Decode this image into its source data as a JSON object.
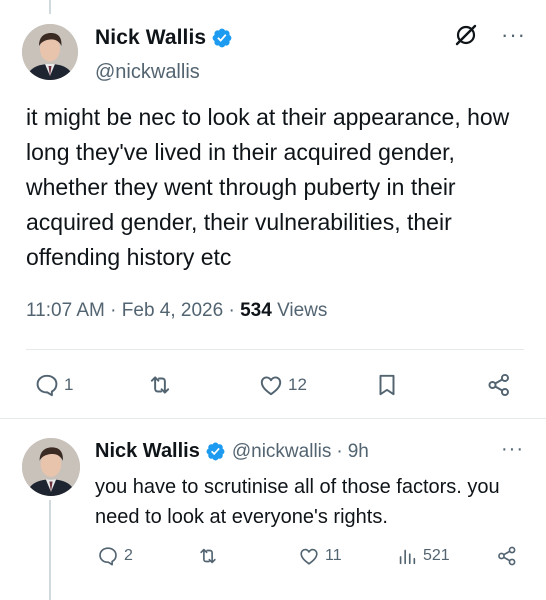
{
  "main_post": {
    "author_name": "Nick Wallis",
    "author_handle": "@nickwallis",
    "text": "it might be nec to look at their appearance, how long they've lived in their acquired gender, whether they went through puberty in their acquired gender, their vulnerabilities, their offending history etc",
    "time": "11:07 AM",
    "separator": "·",
    "date": "Feb 4, 2026",
    "views_count": "534",
    "views_label": "Views",
    "replies": "1",
    "reposts": "",
    "likes": "12",
    "more_label": "···"
  },
  "reply_post": {
    "author_name": "Nick Wallis",
    "author_handle": "@nickwallis",
    "separator": "·",
    "age": "9h",
    "text": "you have to scrutinise all of those factors. you need to look at everyone's rights.",
    "replies": "2",
    "reposts": "",
    "likes": "11",
    "views": "521",
    "more_label": "···"
  },
  "colors": {
    "verified": "#1d9bf0",
    "text": "#0f1419",
    "muted": "#536471",
    "divider": "#e4e9ec"
  },
  "icons": [
    "verified-badge-icon",
    "grok-icon",
    "more-icon",
    "reply-icon",
    "repost-icon",
    "like-icon",
    "bookmark-icon",
    "share-icon",
    "views-icon"
  ]
}
